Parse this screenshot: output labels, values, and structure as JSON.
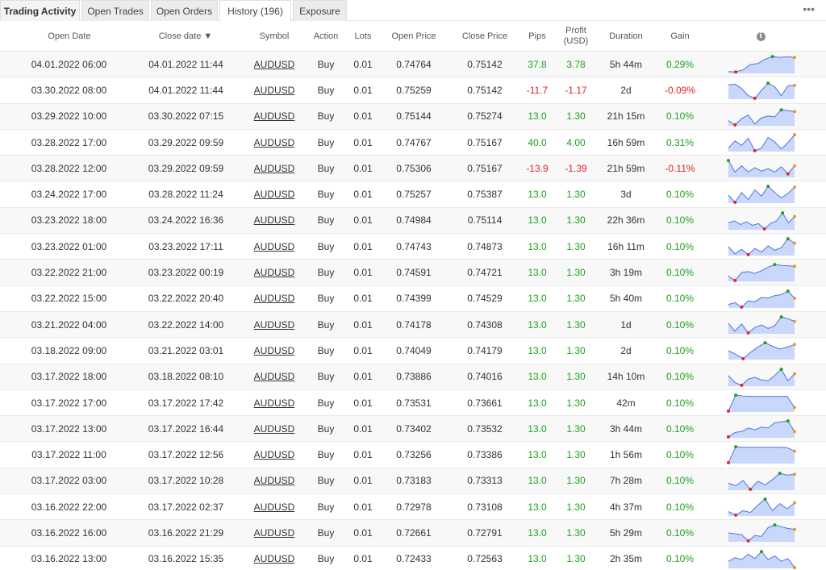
{
  "tabs": [
    {
      "label": "Trading Activity",
      "name": "tab-trading-activity"
    },
    {
      "label": "Open Trades",
      "name": "tab-open-trades"
    },
    {
      "label": "Open Orders",
      "name": "tab-open-orders"
    },
    {
      "label": "History (196)",
      "name": "tab-history"
    },
    {
      "label": "Exposure",
      "name": "tab-exposure"
    }
  ],
  "more_label": "•••",
  "headers": {
    "open_date": "Open Date",
    "close_date": "Close date ▼",
    "symbol": "Symbol",
    "action": "Action",
    "lots": "Lots",
    "open_price": "Open Price",
    "close_price": "Close Price",
    "pips": "Pips",
    "profit_line1": "Profit",
    "profit_line2": "(USD)",
    "duration": "Duration",
    "gain": "Gain",
    "info_icon": "i"
  },
  "colors": {
    "positive": "#1aa31a",
    "negative": "#e0262b",
    "spark_fill": "#c9d7fb",
    "spark_line": "#4f74e6",
    "spark_low": "#e0262b",
    "spark_high": "#1aa31a",
    "spark_end": "#f0962a"
  },
  "rows": [
    {
      "open": "04.01.2022 06:00",
      "close": "04.01.2022 11:44",
      "symbol": "AUDUSD",
      "action": "Buy",
      "lots": "0.01",
      "open_price": "0.74764",
      "close_price": "0.75142",
      "pips": "37.8",
      "profit": "3.78",
      "duration": "5h 44m",
      "gain": "0.29%",
      "neg": false,
      "spark": [
        0.1,
        0.08,
        0.2,
        0.5,
        0.55,
        0.8,
        0.95,
        0.9,
        0.93,
        0.9
      ]
    },
    {
      "open": "03.30.2022 08:00",
      "close": "04.01.2022 11:44",
      "symbol": "AUDUSD",
      "action": "Buy",
      "lots": "0.01",
      "open_price": "0.75259",
      "close_price": "0.75142",
      "pips": "-11.7",
      "profit": "-1.17",
      "duration": "2d",
      "gain": "-0.09%",
      "neg": true,
      "spark": [
        0.8,
        0.85,
        0.6,
        0.2,
        0.05,
        0.5,
        0.9,
        0.7,
        0.2,
        0.75,
        0.78
      ]
    },
    {
      "open": "03.29.2022 10:00",
      "close": "03.30.2022 07:15",
      "symbol": "AUDUSD",
      "action": "Buy",
      "lots": "0.01",
      "open_price": "0.75144",
      "close_price": "0.75274",
      "pips": "13.0",
      "profit": "1.30",
      "duration": "21h 15m",
      "gain": "0.10%",
      "neg": false,
      "spark": [
        0.3,
        0.05,
        0.4,
        0.6,
        0.1,
        0.45,
        0.55,
        0.5,
        0.9,
        0.85,
        0.8
      ]
    },
    {
      "open": "03.28.2022 17:00",
      "close": "03.29.2022 09:59",
      "symbol": "AUDUSD",
      "action": "Buy",
      "lots": "0.01",
      "open_price": "0.74767",
      "close_price": "0.75167",
      "pips": "40.0",
      "profit": "4.00",
      "duration": "16h 59m",
      "gain": "0.31%",
      "neg": false,
      "spark": [
        0.2,
        0.6,
        0.35,
        0.75,
        0.05,
        0.2,
        0.8,
        0.55,
        0.15,
        0.5,
        0.95
      ]
    },
    {
      "open": "03.28.2022 12:00",
      "close": "03.29.2022 09:59",
      "symbol": "AUDUSD",
      "action": "Buy",
      "lots": "0.01",
      "open_price": "0.75306",
      "close_price": "0.75167",
      "pips": "-13.9",
      "profit": "-1.39",
      "duration": "21h 59m",
      "gain": "-0.11%",
      "neg": true,
      "spark": [
        0.95,
        0.3,
        0.65,
        0.3,
        0.55,
        0.35,
        0.5,
        0.3,
        0.6,
        0.2,
        0.65
      ]
    },
    {
      "open": "03.24.2022 17:00",
      "close": "03.28.2022 11:24",
      "symbol": "AUDUSD",
      "action": "Buy",
      "lots": "0.01",
      "open_price": "0.75257",
      "close_price": "0.75387",
      "pips": "13.0",
      "profit": "1.30",
      "duration": "3d",
      "gain": "0.10%",
      "neg": false,
      "spark": [
        0.45,
        0.05,
        0.6,
        0.2,
        0.75,
        0.4,
        0.95,
        0.6,
        0.3,
        0.55,
        0.9
      ]
    },
    {
      "open": "03.23.2022 18:00",
      "close": "03.24.2022 16:36",
      "symbol": "AUDUSD",
      "action": "Buy",
      "lots": "0.01",
      "open_price": "0.74984",
      "close_price": "0.75114",
      "pips": "13.0",
      "profit": "1.30",
      "duration": "22h 36m",
      "gain": "0.10%",
      "neg": false,
      "spark": [
        0.4,
        0.5,
        0.3,
        0.45,
        0.25,
        0.35,
        0.05,
        0.35,
        0.5,
        0.95,
        0.4,
        0.75
      ]
    },
    {
      "open": "03.23.2022 01:00",
      "close": "03.23.2022 17:11",
      "symbol": "AUDUSD",
      "action": "Buy",
      "lots": "0.01",
      "open_price": "0.74743",
      "close_price": "0.74873",
      "pips": "13.0",
      "profit": "1.30",
      "duration": "16h 11m",
      "gain": "0.10%",
      "neg": false,
      "spark": [
        0.5,
        0.1,
        0.35,
        0.05,
        0.4,
        0.2,
        0.55,
        0.3,
        0.45,
        0.95,
        0.7
      ]
    },
    {
      "open": "03.22.2022 21:00",
      "close": "03.23.2022 00:19",
      "symbol": "AUDUSD",
      "action": "Buy",
      "lots": "0.01",
      "open_price": "0.74591",
      "close_price": "0.74721",
      "pips": "13.0",
      "profit": "1.30",
      "duration": "3h 19m",
      "gain": "0.10%",
      "neg": false,
      "spark": [
        0.3,
        0.05,
        0.5,
        0.55,
        0.45,
        0.6,
        0.8,
        0.95,
        0.9,
        0.88,
        0.85
      ]
    },
    {
      "open": "03.22.2022 15:00",
      "close": "03.22.2022 20:40",
      "symbol": "AUDUSD",
      "action": "Buy",
      "lots": "0.01",
      "open_price": "0.74399",
      "close_price": "0.74529",
      "pips": "13.0",
      "profit": "1.30",
      "duration": "5h 40m",
      "gain": "0.10%",
      "neg": false,
      "spark": [
        0.2,
        0.3,
        0.05,
        0.4,
        0.35,
        0.6,
        0.55,
        0.7,
        0.75,
        0.95,
        0.55
      ]
    },
    {
      "open": "03.21.2022 04:00",
      "close": "03.22.2022 14:00",
      "symbol": "AUDUSD",
      "action": "Buy",
      "lots": "0.01",
      "open_price": "0.74178",
      "close_price": "0.74308",
      "pips": "13.0",
      "profit": "1.30",
      "duration": "1d",
      "gain": "0.10%",
      "neg": false,
      "spark": [
        0.6,
        0.15,
        0.55,
        0.05,
        0.35,
        0.5,
        0.3,
        0.45,
        0.95,
        0.85,
        0.7
      ]
    },
    {
      "open": "03.18.2022 09:00",
      "close": "03.21.2022 03:01",
      "symbol": "AUDUSD",
      "action": "Buy",
      "lots": "0.01",
      "open_price": "0.74049",
      "close_price": "0.74179",
      "pips": "13.0",
      "profit": "1.30",
      "duration": "2d",
      "gain": "0.10%",
      "neg": false,
      "spark": [
        0.5,
        0.3,
        0.05,
        0.4,
        0.7,
        0.95,
        0.75,
        0.6,
        0.7,
        0.85
      ]
    },
    {
      "open": "03.17.2022 18:00",
      "close": "03.18.2022 08:10",
      "symbol": "AUDUSD",
      "action": "Buy",
      "lots": "0.01",
      "open_price": "0.73886",
      "close_price": "0.74016",
      "pips": "13.0",
      "profit": "1.30",
      "duration": "14h 10m",
      "gain": "0.10%",
      "neg": false,
      "spark": [
        0.6,
        0.2,
        0.05,
        0.4,
        0.5,
        0.35,
        0.3,
        0.6,
        0.95,
        0.3,
        0.7
      ]
    },
    {
      "open": "03.17.2022 17:00",
      "close": "03.17.2022 17:42",
      "symbol": "AUDUSD",
      "action": "Buy",
      "lots": "0.01",
      "open_price": "0.73531",
      "close_price": "0.73661",
      "pips": "13.0",
      "profit": "1.30",
      "duration": "42m",
      "gain": "0.10%",
      "neg": false,
      "spark": [
        0.05,
        0.95,
        0.9,
        0.88,
        0.88,
        0.88,
        0.88,
        0.88,
        0.88,
        0.25
      ]
    },
    {
      "open": "03.17.2022 13:00",
      "close": "03.17.2022 16:44",
      "symbol": "AUDUSD",
      "action": "Buy",
      "lots": "0.01",
      "open_price": "0.73402",
      "close_price": "0.73532",
      "pips": "13.0",
      "profit": "1.30",
      "duration": "3h 44m",
      "gain": "0.10%",
      "neg": false,
      "spark": [
        0.05,
        0.3,
        0.35,
        0.55,
        0.45,
        0.6,
        0.55,
        0.85,
        0.9,
        0.95,
        0.35
      ]
    },
    {
      "open": "03.17.2022 11:00",
      "close": "03.17.2022 12:56",
      "symbol": "AUDUSD",
      "action": "Buy",
      "lots": "0.01",
      "open_price": "0.73256",
      "close_price": "0.73386",
      "pips": "13.0",
      "profit": "1.30",
      "duration": "1h 56m",
      "gain": "0.10%",
      "neg": false,
      "spark": [
        0.05,
        0.95,
        0.92,
        0.92,
        0.92,
        0.92,
        0.92,
        0.92,
        0.9,
        0.7
      ]
    },
    {
      "open": "03.17.2022 03:00",
      "close": "03.17.2022 10:28",
      "symbol": "AUDUSD",
      "action": "Buy",
      "lots": "0.01",
      "open_price": "0.73183",
      "close_price": "0.73313",
      "pips": "13.0",
      "profit": "1.30",
      "duration": "7h 28m",
      "gain": "0.10%",
      "neg": false,
      "spark": [
        0.4,
        0.25,
        0.55,
        0.05,
        0.5,
        0.3,
        0.6,
        0.95,
        0.85,
        0.9
      ]
    },
    {
      "open": "03.16.2022 22:00",
      "close": "03.17.2022 02:37",
      "symbol": "AUDUSD",
      "action": "Buy",
      "lots": "0.01",
      "open_price": "0.72978",
      "close_price": "0.73108",
      "pips": "13.0",
      "profit": "1.30",
      "duration": "4h 37m",
      "gain": "0.10%",
      "neg": false,
      "spark": [
        0.25,
        0.05,
        0.3,
        0.2,
        0.6,
        0.95,
        0.3,
        0.7,
        0.4,
        0.75
      ]
    },
    {
      "open": "03.16.2022 16:00",
      "close": "03.16.2022 21:29",
      "symbol": "AUDUSD",
      "action": "Buy",
      "lots": "0.01",
      "open_price": "0.72661",
      "close_price": "0.72791",
      "pips": "13.0",
      "profit": "1.30",
      "duration": "5h 29m",
      "gain": "0.10%",
      "neg": false,
      "spark": [
        0.5,
        0.45,
        0.4,
        0.05,
        0.35,
        0.3,
        0.8,
        0.95,
        0.85,
        0.75,
        0.7
      ]
    },
    {
      "open": "03.16.2022 13:00",
      "close": "03.16.2022 15:35",
      "symbol": "AUDUSD",
      "action": "Buy",
      "lots": "0.01",
      "open_price": "0.72433",
      "close_price": "0.72563",
      "pips": "13.0",
      "profit": "1.30",
      "duration": "2h 35m",
      "gain": "0.10%",
      "neg": false,
      "spark": [
        0.4,
        0.6,
        0.5,
        0.8,
        0.55,
        0.95,
        0.5,
        0.7,
        0.4,
        0.55,
        0.05
      ]
    }
  ]
}
